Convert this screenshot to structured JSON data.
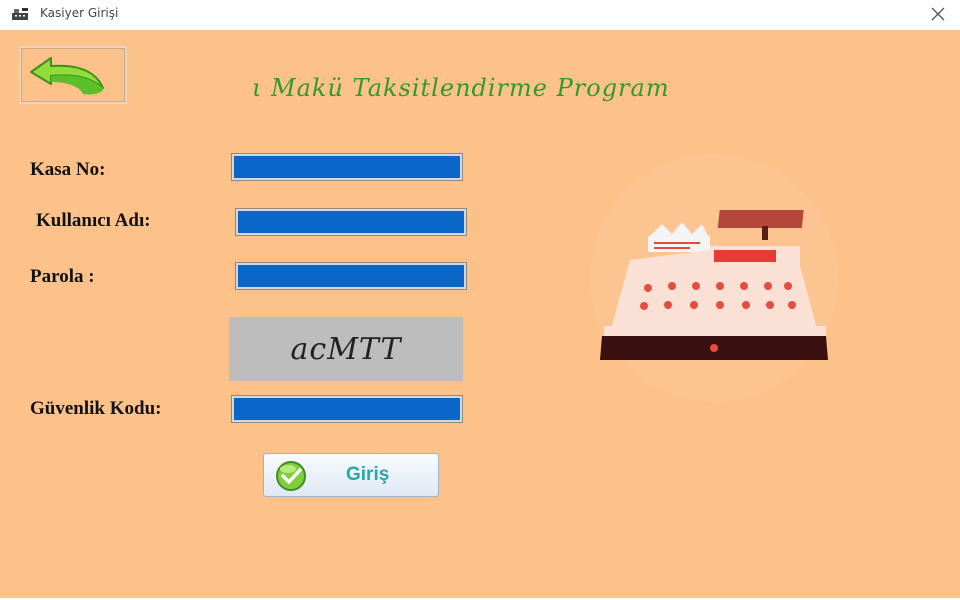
{
  "window": {
    "title": "Kasiyer Girişi"
  },
  "header": {
    "program_title": "ι  Makü Taksitlendirme Program"
  },
  "form": {
    "kasa_no": {
      "label": "Kasa No:",
      "value": ""
    },
    "kullanici_adi": {
      "label": "Kullanıcı Adı:",
      "value": ""
    },
    "parola": {
      "label": "Parola :",
      "value": ""
    },
    "captcha_text": "acMTT",
    "guvenlik_kodu": {
      "label": "Güvenlik Kodu:",
      "value": ""
    },
    "login_label": "Giriş"
  },
  "icons": {
    "back": "back-arrow-icon",
    "check": "checkmark-icon",
    "close": "close-icon",
    "app": "cash-register-icon",
    "illustration": "cash-register-illustration"
  },
  "colors": {
    "background": "#fdc18a",
    "field": "#0a66c8",
    "title_green": "#2f9c2a",
    "login_text": "#27a7a7",
    "captcha_bg": "#bdbdbd"
  }
}
